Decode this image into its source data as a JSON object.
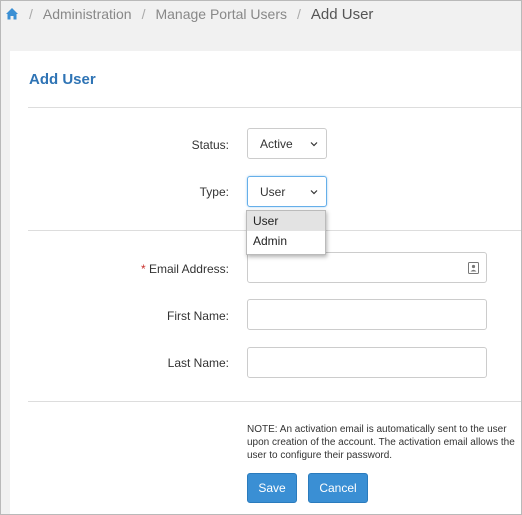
{
  "breadcrumb": {
    "items": [
      "Administration",
      "Manage Portal Users"
    ],
    "current": "Add User"
  },
  "form": {
    "title": "Add User",
    "status_label": "Status:",
    "status_value": "Active",
    "type_label": "Type:",
    "type_value": "User",
    "type_options": [
      "User",
      "Admin"
    ],
    "email_required_mark": "*",
    "email_label": "Email Address:",
    "first_name_label": "First Name:",
    "last_name_label": "Last Name:",
    "note": "NOTE: An activation email is automatically sent to the user upon creation of the account. The activation email allows the user to configure their password.",
    "save_label": "Save",
    "cancel_label": "Cancel"
  },
  "colors": {
    "accent": "#2f74b5",
    "button": "#3a8fd4"
  }
}
